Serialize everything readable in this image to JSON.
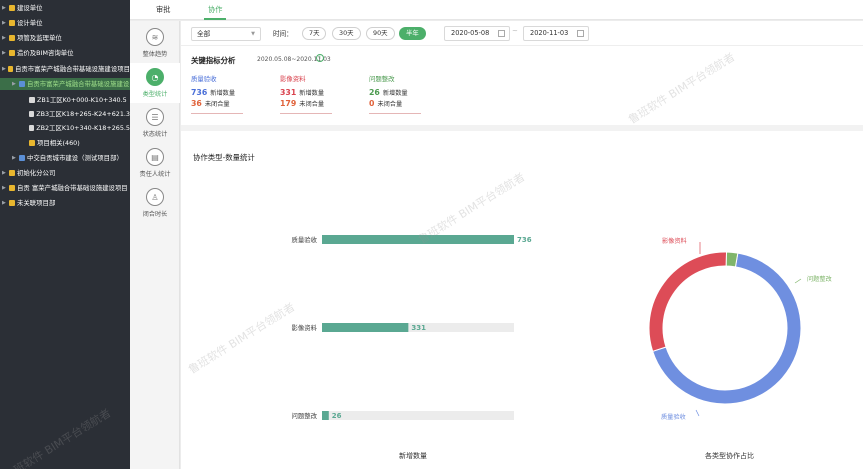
{
  "tree": {
    "items": [
      {
        "label": "建设单位",
        "level": 0,
        "icon": "folder-icon"
      },
      {
        "label": "设计单位",
        "level": 0,
        "icon": "folder-icon"
      },
      {
        "label": "项管及监理单位",
        "level": 0,
        "icon": "folder-icon"
      },
      {
        "label": "造价及BIM咨询单位",
        "level": 0,
        "icon": "folder-icon"
      },
      {
        "label": "自贡市富荣产城融合带基础设施建设项目",
        "level": 0,
        "icon": "folder-icon"
      },
      {
        "label": "自贡市富荣产城融合带基础设施建设",
        "level": 1,
        "icon": "project-icon",
        "active": true
      },
      {
        "label": "ZB1工区K0+000-K10+340.5",
        "level": 2,
        "icon": "document-icon"
      },
      {
        "label": "ZB3工区K18+265-K24+621.3",
        "level": 2,
        "icon": "document-icon"
      },
      {
        "label": "ZB2工区K10+340-K18+265.5",
        "level": 2,
        "icon": "document-icon"
      },
      {
        "label": "项目相关(460)",
        "level": 2,
        "icon": "folder-icon"
      },
      {
        "label": "中交自贡城市建设（测试项目部）",
        "level": 1,
        "icon": "project-icon"
      },
      {
        "label": "初始化分公司",
        "level": 0,
        "icon": "folder-icon"
      },
      {
        "label": "自贡 富荣产城融合带基础设施建设项目",
        "level": 0,
        "icon": "folder-icon"
      },
      {
        "label": "未关联项目部",
        "level": 0,
        "icon": "folder-icon"
      }
    ]
  },
  "tabs": [
    {
      "label": "审批",
      "active": false
    },
    {
      "label": "协作",
      "active": true
    }
  ],
  "subnav": [
    {
      "label": "整体趋势",
      "icon": "trend-icon",
      "active": false
    },
    {
      "label": "类型统计",
      "icon": "type-stats-icon",
      "active": true
    },
    {
      "label": "状态统计",
      "icon": "status-stats-icon",
      "active": false
    },
    {
      "label": "责任人统计",
      "icon": "person-stats-icon",
      "active": false
    },
    {
      "label": "闭合时长",
      "icon": "close-duration-icon",
      "active": false
    }
  ],
  "filter": {
    "scope": "全部",
    "time_label": "时间：",
    "ranges": [
      {
        "label": "7天",
        "active": false
      },
      {
        "label": "30天",
        "active": false
      },
      {
        "label": "90天",
        "active": false
      },
      {
        "label": "半年",
        "active": true
      }
    ],
    "start_date": "2020-05-08",
    "end_date": "2020-11-03",
    "separator": "~"
  },
  "kpi": {
    "title": "关键指标分析",
    "range": "2020.05.08~2020.11.03",
    "new_label": "新增数量",
    "open_label": "未闭合量",
    "items": [
      {
        "name": "质量验收",
        "new": "736",
        "open": "36",
        "color": "#4a6fd8"
      },
      {
        "name": "影像资料",
        "new": "331",
        "open": "179",
        "color": "#d9434e"
      },
      {
        "name": "问题整改",
        "new": "26",
        "open": "0",
        "color": "#4b9a4f"
      }
    ]
  },
  "chart_title": "协作类型-数量统计",
  "bar_footer": "新增数量",
  "pie_footer": "各类型协作占比",
  "watermark": "鲁班软件 BIM平台领航者",
  "colors": {
    "accent": "#4caf6a",
    "bar": "#5aa892",
    "pie_blue": "#6f8fe0",
    "pie_red": "#dd4c57",
    "pie_green": "#7fb56a"
  },
  "chart_data": {
    "type": "bar",
    "orientation": "horizontal",
    "categories": [
      "质量验收",
      "影像资料",
      "问题整改"
    ],
    "values": [
      736,
      331,
      26
    ],
    "xlim": [
      0,
      736
    ],
    "pie": {
      "type": "pie",
      "labels": [
        "质量验收",
        "影像资料",
        "问题整改"
      ],
      "values": [
        736,
        331,
        26
      ]
    }
  }
}
